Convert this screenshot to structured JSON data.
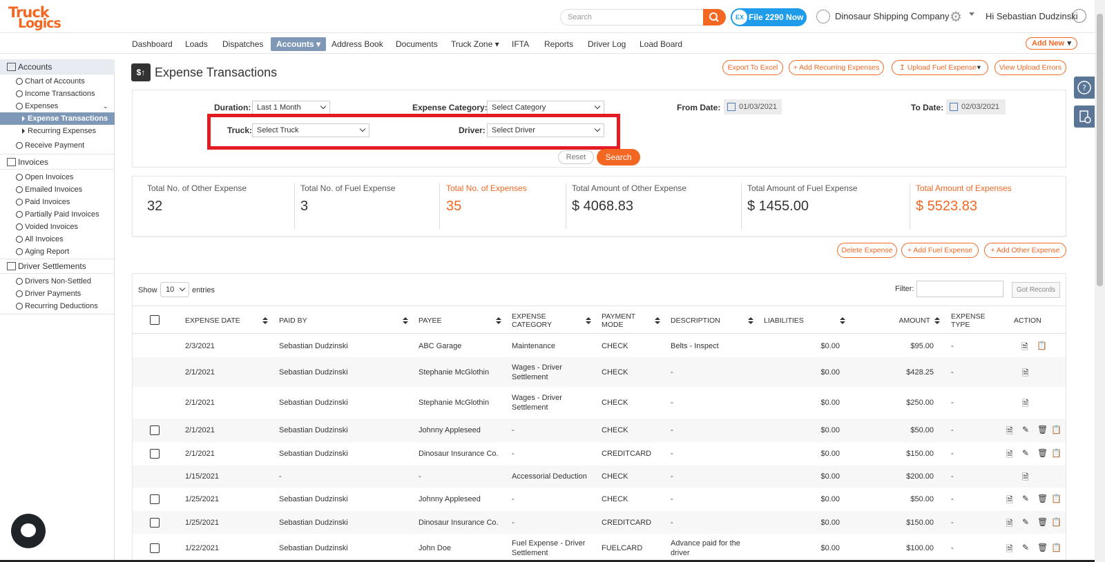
{
  "app": {
    "logo_line1": "Truck",
    "logo_line2": "Logics",
    "search_placeholder": "Search",
    "file2290_label": "File 2290 Now",
    "file2290_badge": "EX",
    "company": "Dinosaur Shipping Company",
    "greeting": "Hi Sebastian Dudzinski"
  },
  "nav": {
    "items": [
      "Dashboard",
      "Loads",
      "Dispatches",
      "Accounts",
      "Address Book",
      "Documents",
      "Truck Zone",
      "IFTA",
      "Reports",
      "Driver Log",
      "Load Board"
    ],
    "active": "Accounts",
    "add_new": "Add New"
  },
  "sidebar": {
    "accounts": "Accounts",
    "chart_of_accounts": "Chart of Accounts",
    "income_transactions": "Income Transactions",
    "expenses": "Expenses",
    "expense_transactions": "Expense Transactions",
    "recurring_expenses": "Recurring Expenses",
    "receive_payment": "Receive Payment",
    "invoices": "Invoices",
    "open_invoices": "Open Invoices",
    "emailed_invoices": "Emailed Invoices",
    "paid_invoices": "Paid Invoices",
    "partially_paid_invoices": "Partially Paid Invoices",
    "voided_invoices": "Voided Invoices",
    "all_invoices": "All Invoices",
    "aging_report": "Aging Report",
    "driver_settlements": "Driver Settlements",
    "drivers_non_settled": "Drivers Non-Settled",
    "driver_payments": "Driver Payments",
    "recurring_deductions": "Recurring Deductions"
  },
  "page": {
    "title": "Expense Transactions",
    "title_icon": "$↑",
    "export_excel": "Export To Excel",
    "add_recurring": "+ Add Recurring Expenses",
    "upload_fuel": "↥ Upload Fuel Expense",
    "view_upload_errors": "View Upload Errors"
  },
  "filters": {
    "duration_label": "Duration:",
    "duration_value": "Last 1 Month",
    "category_label": "Expense Category:",
    "category_value": "Select Category",
    "from_label": "From Date:",
    "from_value": "01/03/2021",
    "to_label": "To Date:",
    "to_value": "02/03/2021",
    "truck_label": "Truck:",
    "truck_value": "Select Truck",
    "driver_label": "Driver:",
    "driver_value": "Select Driver",
    "reset": "Reset",
    "search": "Search"
  },
  "stats": [
    {
      "label": "Total No. of Other Expense",
      "value": "32"
    },
    {
      "label": "Total No. of Fuel Expense",
      "value": "3"
    },
    {
      "label": "Total No. of Expenses",
      "value": "35"
    },
    {
      "label": "Total Amount of Other Expense",
      "value": "$ 4068.83"
    },
    {
      "label": "Total Amount of Fuel Expense",
      "value": "$ 1455.00"
    },
    {
      "label": "Total Amount of Expenses",
      "value": "$ 5523.83"
    }
  ],
  "actions": {
    "delete_expense": "Delete Expense",
    "add_fuel": "+ Add Fuel Expense",
    "add_other": "+ Add Other Expense"
  },
  "table": {
    "show": "Show",
    "entries_value": "10",
    "entries": "entries",
    "filter": "Filter:",
    "got_records": "Got Records",
    "headers": [
      "EXPENSE DATE",
      "PAID BY",
      "PAYEE",
      "EXPENSE CATEGORY",
      "PAYMENT MODE",
      "DESCRIPTION",
      "LIABILITIES",
      "AMOUNT",
      "EXPENSE TYPE",
      "ACTION"
    ],
    "rows": [
      {
        "date": "2/3/2021",
        "paid_by": "Sebastian Dudzinski",
        "payee": "ABC Garage",
        "category": "Maintenance",
        "mode": "CHECK",
        "desc": "Belts - Inspect",
        "liab": "$0.00",
        "amount": "$95.00",
        "type": "-"
      },
      {
        "date": "2/1/2021",
        "paid_by": "Sebastian Dudzinski",
        "payee": "Stephanie McGlothin",
        "category": "Wages - Driver Settlement",
        "mode": "CHECK",
        "desc": "-",
        "liab": "$0.00",
        "amount": "$428.25",
        "type": "-"
      },
      {
        "date": "2/1/2021",
        "paid_by": "Sebastian Dudzinski",
        "payee": "Stephanie McGlothin",
        "category": "Wages - Driver Settlement",
        "mode": "CHECK",
        "desc": "-",
        "liab": "$0.00",
        "amount": "$250.00",
        "type": "-"
      },
      {
        "date": "2/1/2021",
        "paid_by": "Sebastian Dudzinski",
        "payee": "Johnny Appleseed",
        "category": "-",
        "mode": "CHECK",
        "desc": "-",
        "liab": "$0.00",
        "amount": "$50.00",
        "type": "-"
      },
      {
        "date": "2/1/2021",
        "paid_by": "Sebastian Dudzinski",
        "payee": "Dinosaur Insurance Co.",
        "category": "-",
        "mode": "CREDITCARD",
        "desc": "-",
        "liab": "$0.00",
        "amount": "$150.00",
        "type": "-"
      },
      {
        "date": "1/15/2021",
        "paid_by": "-",
        "payee": "-",
        "category": "Accessorial Deduction",
        "mode": "CHECK",
        "desc": "-",
        "liab": "$0.00",
        "amount": "$200.00",
        "type": "-"
      },
      {
        "date": "1/25/2021",
        "paid_by": "Sebastian Dudzinski",
        "payee": "Johnny Appleseed",
        "category": "-",
        "mode": "CHECK",
        "desc": "-",
        "liab": "$0.00",
        "amount": "$50.00",
        "type": "-"
      },
      {
        "date": "1/25/2021",
        "paid_by": "Sebastian Dudzinski",
        "payee": "Dinosaur Insurance Co.",
        "category": "-",
        "mode": "CREDITCARD",
        "desc": "-",
        "liab": "$0.00",
        "amount": "$150.00",
        "type": "-"
      },
      {
        "date": "1/22/2021",
        "paid_by": "Sebastian Dudzinski",
        "payee": "John Doe",
        "category": "Fuel Expense - Driver Settlement",
        "mode": "FUELCARD",
        "desc": "Advance paid for the driver",
        "liab": "$0.00",
        "amount": "$100.00",
        "type": "-"
      }
    ]
  },
  "colors": {
    "accent": "#f26722",
    "nav_active": "#7f98b8",
    "highlight": "#e31b23",
    "file2290": "#1e9be9"
  }
}
